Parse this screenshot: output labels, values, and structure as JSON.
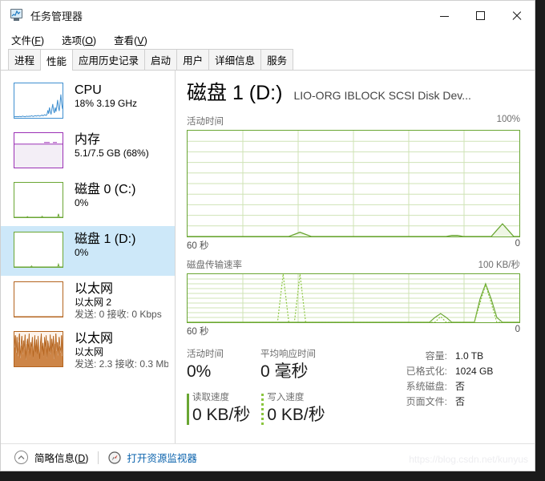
{
  "window": {
    "title": "任务管理器",
    "icon": "task-manager-icon",
    "controls": {
      "minimize": "–",
      "maximize": "□",
      "close": "✕"
    }
  },
  "menubar": [
    {
      "label": "文件",
      "accel": "F"
    },
    {
      "label": "选项",
      "accel": "O"
    },
    {
      "label": "查看",
      "accel": "V"
    }
  ],
  "tabs": [
    {
      "label": "进程",
      "active": false
    },
    {
      "label": "性能",
      "active": true
    },
    {
      "label": "应用历史记录",
      "active": false
    },
    {
      "label": "启动",
      "active": false
    },
    {
      "label": "用户",
      "active": false
    },
    {
      "label": "详细信息",
      "active": false
    },
    {
      "label": "服务",
      "active": false
    }
  ],
  "sidebar": {
    "items": [
      {
        "name": "CPU",
        "line2": "18% 3.19 GHz",
        "line3": "",
        "color": "#3f8fd0",
        "selected": false
      },
      {
        "name": "内存",
        "line2": "5.1/7.5 GB (68%)",
        "line3": "",
        "color": "#9b30b5",
        "selected": false
      },
      {
        "name": "磁盘 0 (C:)",
        "line2": "0%",
        "line3": "",
        "color": "#6aa633",
        "selected": false
      },
      {
        "name": "磁盘 1 (D:)",
        "line2": "0%",
        "line3": "",
        "color": "#6aa633",
        "selected": true
      },
      {
        "name": "以太网",
        "line2": "以太网 2",
        "line3": "发送: 0 接收: 0 Kbps",
        "color": "#b4641e",
        "selected": false
      },
      {
        "name": "以太网",
        "line2": "以太网",
        "line3": "发送: 2.3 接收: 0.3 Mb",
        "color": "#b4641e",
        "selected": false
      }
    ]
  },
  "main": {
    "title": "磁盘 1 (D:)",
    "subtitle": "LIO-ORG IBLOCK SCSI Disk Dev...",
    "stats_left": [
      {
        "caption": "活动时间",
        "value": "0%"
      },
      {
        "caption": "平均响应时间",
        "value": "0 毫秒"
      }
    ],
    "rw": [
      {
        "caption": "读取速度",
        "value": "0 KB/秒",
        "style": "solid"
      },
      {
        "caption": "写入速度",
        "value": "0 KB/秒",
        "style": "dashed"
      }
    ],
    "info": [
      {
        "key": "容量:",
        "value": "1.0 TB"
      },
      {
        "key": "已格式化:",
        "value": "1024 GB"
      },
      {
        "key": "系统磁盘:",
        "value": "否"
      },
      {
        "key": "页面文件:",
        "value": "否"
      }
    ]
  },
  "statusbar": {
    "fewer_details": "简略信息",
    "fewer_details_accel": "D",
    "chevron_icon": "chevron-up-icon",
    "resmon_icon": "resource-monitor-icon",
    "resmon_label": "打开资源监视器"
  },
  "watermark": "https://blog.csdn.net/kunyus",
  "chart_data": [
    {
      "type": "area",
      "title": "活动时间",
      "ymax_label": "100%",
      "xleft_label": "60 秒",
      "xright_label": "0",
      "ylim": [
        0,
        100
      ],
      "grid": {
        "cols": 6,
        "rows": 10
      },
      "line_color": "#6aa633",
      "fill_color": "#eef6e4",
      "series": [
        {
          "name": "活动时间",
          "values": [
            0,
            0,
            0,
            0,
            0,
            0,
            0,
            0,
            0,
            0,
            0,
            0,
            0,
            0,
            0,
            0,
            0,
            0,
            0,
            2,
            4,
            2,
            0,
            0,
            0,
            0,
            0,
            0,
            0,
            0,
            0,
            0,
            0,
            0,
            0,
            0,
            0,
            0,
            0,
            0,
            0,
            0,
            0,
            0,
            0,
            0,
            0,
            1,
            1,
            0,
            0,
            0,
            0,
            0,
            0,
            6,
            12,
            6,
            0,
            0
          ]
        }
      ]
    },
    {
      "type": "line",
      "title": "磁盘传输速率",
      "ymax_label": "100 KB/秒",
      "xleft_label": "60 秒",
      "xright_label": "0",
      "ylim": [
        0,
        100
      ],
      "grid": {
        "cols": 6,
        "rows": 10
      },
      "read_color": "#6aa633",
      "write_color": "#8ac53e",
      "series": [
        {
          "name": "读取速度",
          "style": "solid",
          "values": [
            0,
            0,
            0,
            0,
            0,
            0,
            0,
            0,
            0,
            0,
            0,
            0,
            0,
            0,
            0,
            0,
            0,
            0,
            0,
            0,
            0,
            0,
            0,
            0,
            0,
            0,
            0,
            0,
            0,
            0,
            0,
            0,
            0,
            0,
            0,
            0,
            0,
            0,
            0,
            0,
            0,
            0,
            0,
            0,
            10,
            18,
            10,
            0,
            0,
            0,
            0,
            0,
            48,
            80,
            48,
            10,
            0,
            0,
            0,
            0
          ]
        },
        {
          "name": "写入速度",
          "style": "dashed",
          "values": [
            0,
            0,
            0,
            0,
            0,
            0,
            0,
            0,
            0,
            0,
            0,
            0,
            0,
            0,
            0,
            0,
            0,
            100,
            0,
            0,
            100,
            0,
            0,
            0,
            0,
            0,
            0,
            0,
            0,
            0,
            0,
            0,
            0,
            0,
            0,
            0,
            0,
            0,
            0,
            0,
            0,
            0,
            0,
            0,
            0,
            12,
            0,
            0,
            0,
            0,
            0,
            0,
            40,
            78,
            40,
            0,
            0,
            0,
            0,
            0
          ]
        }
      ]
    }
  ],
  "mini_charts": {
    "cpu": [
      4,
      3,
      4,
      3,
      4,
      3,
      4,
      4,
      3,
      4,
      5,
      4,
      4,
      3,
      4,
      5,
      4,
      4,
      5,
      4,
      5,
      6,
      5,
      4,
      5,
      6,
      6,
      5,
      6,
      7,
      6,
      5,
      6,
      7,
      8,
      6,
      7,
      9,
      8,
      7,
      10,
      22,
      12,
      30,
      18,
      10,
      26,
      40,
      22,
      14,
      30,
      18,
      34,
      52,
      30,
      20,
      44,
      68,
      40,
      26
    ],
    "memory_fill_pct": 68,
    "disk0": [
      0,
      0,
      0,
      0,
      0,
      0,
      0,
      0,
      0,
      0,
      0,
      0,
      0,
      0,
      0,
      0,
      2,
      0,
      0,
      0,
      0,
      0,
      0,
      0,
      0,
      0,
      0,
      0,
      0,
      0,
      0,
      0,
      0,
      0,
      3,
      0,
      0,
      0,
      0,
      0,
      0,
      0,
      0,
      0,
      0,
      0,
      0,
      0,
      0,
      0,
      0,
      0,
      0,
      0,
      10,
      0,
      0,
      0,
      0,
      0
    ],
    "disk1": [
      0,
      0,
      0,
      0,
      0,
      0,
      0,
      0,
      0,
      0,
      0,
      0,
      0,
      0,
      0,
      0,
      0,
      0,
      0,
      0,
      0,
      3,
      0,
      0,
      0,
      0,
      0,
      0,
      0,
      0,
      0,
      0,
      0,
      0,
      0,
      0,
      0,
      0,
      0,
      0,
      0,
      0,
      0,
      0,
      0,
      0,
      0,
      0,
      0,
      0,
      0,
      0,
      0,
      0,
      8,
      0,
      0,
      0,
      0,
      0
    ],
    "eth2": [
      0,
      0,
      0,
      0,
      0,
      0,
      0,
      0,
      0,
      0,
      0,
      0,
      0,
      0,
      0,
      0,
      0,
      0,
      0,
      0,
      0,
      0,
      0,
      0,
      0,
      0,
      0,
      0,
      0,
      0,
      0,
      0,
      0,
      0,
      0,
      0,
      0,
      0,
      0,
      0,
      0,
      0,
      0,
      0,
      0,
      0,
      0,
      0,
      0,
      0,
      0,
      0,
      0,
      0,
      0,
      0,
      0,
      0,
      0,
      0
    ],
    "eth1": [
      55,
      90,
      40,
      85,
      30,
      70,
      95,
      25,
      60,
      88,
      35,
      75,
      50,
      92,
      20,
      65,
      80,
      45,
      95,
      30,
      70,
      55,
      85,
      25,
      60,
      90,
      40,
      78,
      35,
      88,
      50,
      20,
      72,
      95,
      42,
      68,
      30,
      85,
      55,
      90,
      25,
      75,
      60,
      40,
      92,
      35,
      80,
      50,
      88,
      22,
      65,
      95,
      45,
      70,
      32,
      85,
      58,
      40,
      90,
      30
    ]
  }
}
